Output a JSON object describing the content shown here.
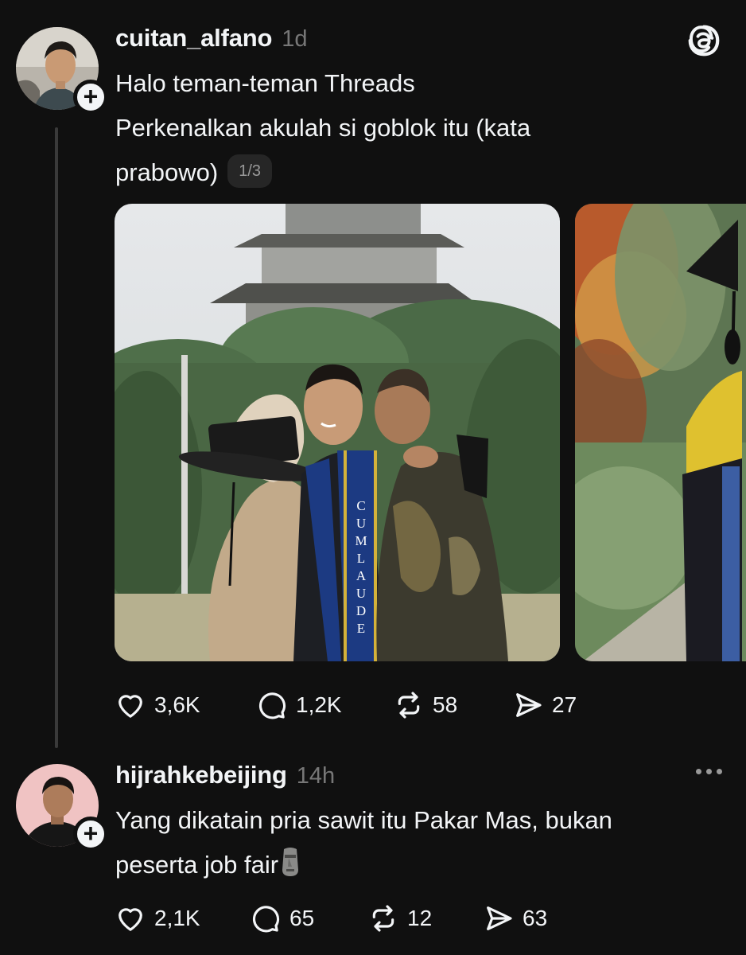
{
  "posts": [
    {
      "username": "cuitan_alfano",
      "time": "1d",
      "lines": [
        "Halo teman-teman Threads",
        "Perkenalkan akulah si goblok itu (kata",
        "prabowo)"
      ],
      "page_indicator": "1/3",
      "media": [
        {
          "description": "graduation photo",
          "sash_text": "CUMLAUDE"
        },
        {
          "description": "graduation photo partial"
        }
      ],
      "stats": {
        "likes": "3,6K",
        "replies": "1,2K",
        "reposts": "58",
        "shares": "27"
      }
    },
    {
      "username": "hijrahkebeijing",
      "time": "14h",
      "lines": [
        "Yang dikatain pria sawit itu Pakar Mas, bukan",
        "peserta job fair"
      ],
      "emoji": "moai",
      "stats": {
        "likes": "2,1K",
        "replies": "65",
        "reposts": "12",
        "shares": "63"
      }
    }
  ],
  "icons": {
    "like": "heart-icon",
    "reply": "speech-bubble-icon",
    "repost": "repost-arrows-icon",
    "share": "paper-plane-icon",
    "follow": "plus-icon",
    "app": "threads-logo-icon",
    "more": "more-dots-icon"
  },
  "colors": {
    "background": "#101010",
    "text": "#f3f5f7",
    "muted": "#777777"
  }
}
